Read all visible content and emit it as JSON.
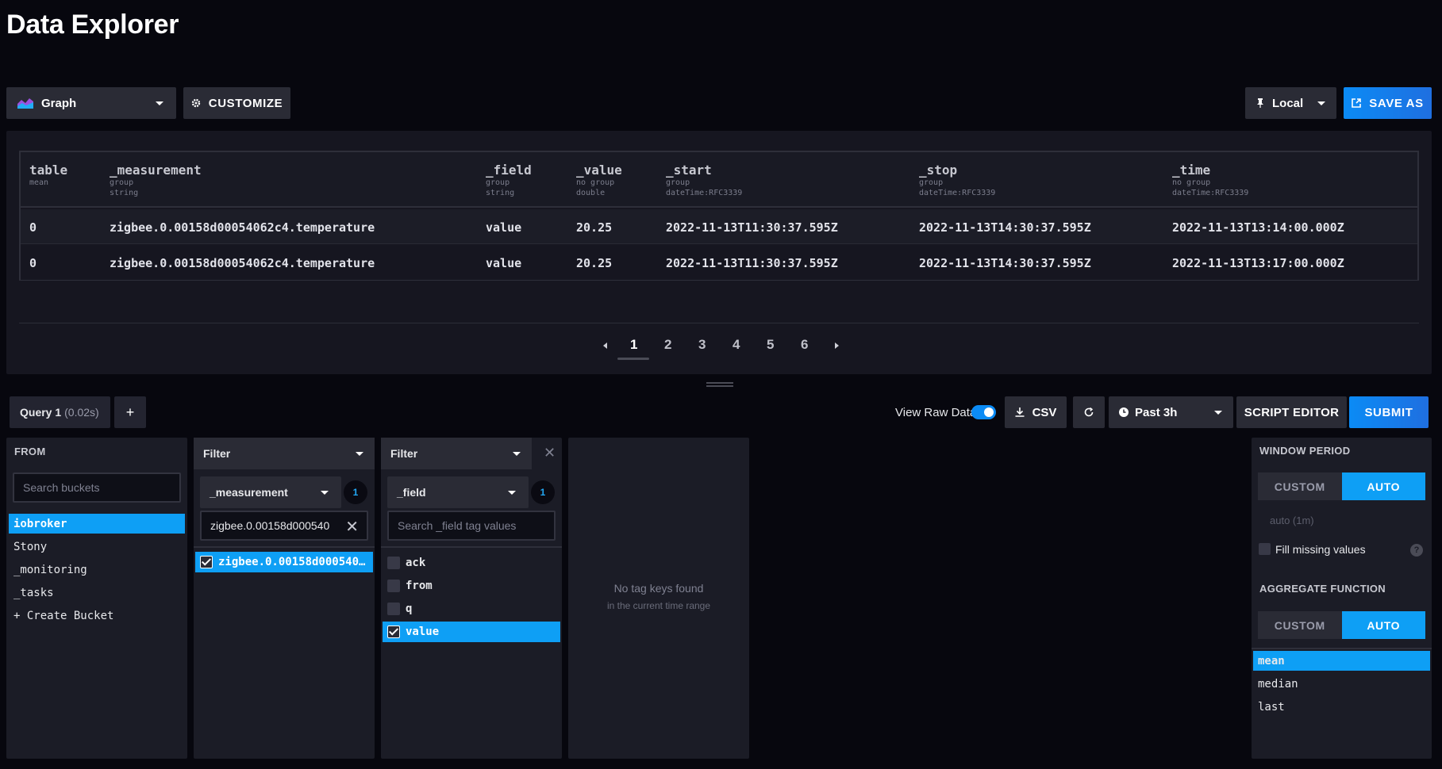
{
  "page": {
    "title": "Data Explorer"
  },
  "toolbar": {
    "viz_type": "Graph",
    "customize_label": "CUSTOMIZE",
    "timezone": "Local",
    "save_as_label": "SAVE AS"
  },
  "table": {
    "columns": [
      {
        "name": "table",
        "sub1": "mean",
        "sub2": ""
      },
      {
        "name": "_measurement",
        "sub1": "group",
        "sub2": "string"
      },
      {
        "name": "_field",
        "sub1": "group",
        "sub2": "string"
      },
      {
        "name": "_value",
        "sub1": "no group",
        "sub2": "double"
      },
      {
        "name": "_start",
        "sub1": "group",
        "sub2": "dateTime:RFC3339"
      },
      {
        "name": "_stop",
        "sub1": "group",
        "sub2": "dateTime:RFC3339"
      },
      {
        "name": "_time",
        "sub1": "no group",
        "sub2": "dateTime:RFC3339"
      }
    ],
    "rows": [
      [
        "0",
        "zigbee.0.00158d00054062c4.temperature",
        "value",
        "20.25",
        "2022-11-13T11:30:37.595Z",
        "2022-11-13T14:30:37.595Z",
        "2022-11-13T13:14:00.000Z"
      ],
      [
        "0",
        "zigbee.0.00158d00054062c4.temperature",
        "value",
        "20.25",
        "2022-11-13T11:30:37.595Z",
        "2022-11-13T14:30:37.595Z",
        "2022-11-13T13:17:00.000Z"
      ]
    ]
  },
  "pagination": {
    "pages": [
      "1",
      "2",
      "3",
      "4",
      "5",
      "6"
    ],
    "current": "1"
  },
  "query": {
    "tab_name": "Query 1",
    "tab_time": "(0.02s)",
    "add_label": "+",
    "view_raw_label": "View Raw Data",
    "view_raw_on": true,
    "csv_label": "CSV",
    "time_range": "Past 3h",
    "script_editor_label": "SCRIPT EDITOR",
    "submit_label": "SUBMIT"
  },
  "from": {
    "title": "FROM",
    "search_placeholder": "Search buckets",
    "buckets": [
      "iobroker",
      "Stony",
      "_monitoring",
      "_tasks",
      "+ Create Bucket"
    ],
    "selected": "iobroker"
  },
  "filter1": {
    "title": "Filter",
    "key": "_measurement",
    "count": "1",
    "search_value": "zigbee.0.00158d000540",
    "values": [
      {
        "label": "zigbee.0.00158d000540…",
        "checked": true
      }
    ]
  },
  "filter2": {
    "title": "Filter",
    "key": "_field",
    "count": "1",
    "search_placeholder": "Search _field tag values",
    "values": [
      {
        "label": "ack",
        "checked": false
      },
      {
        "label": "from",
        "checked": false
      },
      {
        "label": "q",
        "checked": false
      },
      {
        "label": "value",
        "checked": true
      }
    ]
  },
  "empty_builder": {
    "main": "No tag keys found",
    "sub": "in the current time range"
  },
  "aggregate": {
    "window_title": "WINDOW PERIOD",
    "custom_label": "CUSTOM",
    "auto_label": "AUTO",
    "window_placeholder": "auto (1m)",
    "fill_missing_label": "Fill missing values",
    "function_title": "AGGREGATE FUNCTION",
    "functions": [
      "mean",
      "median",
      "last"
    ],
    "selected": "mean"
  },
  "colors": {
    "accent": "#0e9ff5",
    "background": "#07070e",
    "panel": "#1b1c26"
  }
}
